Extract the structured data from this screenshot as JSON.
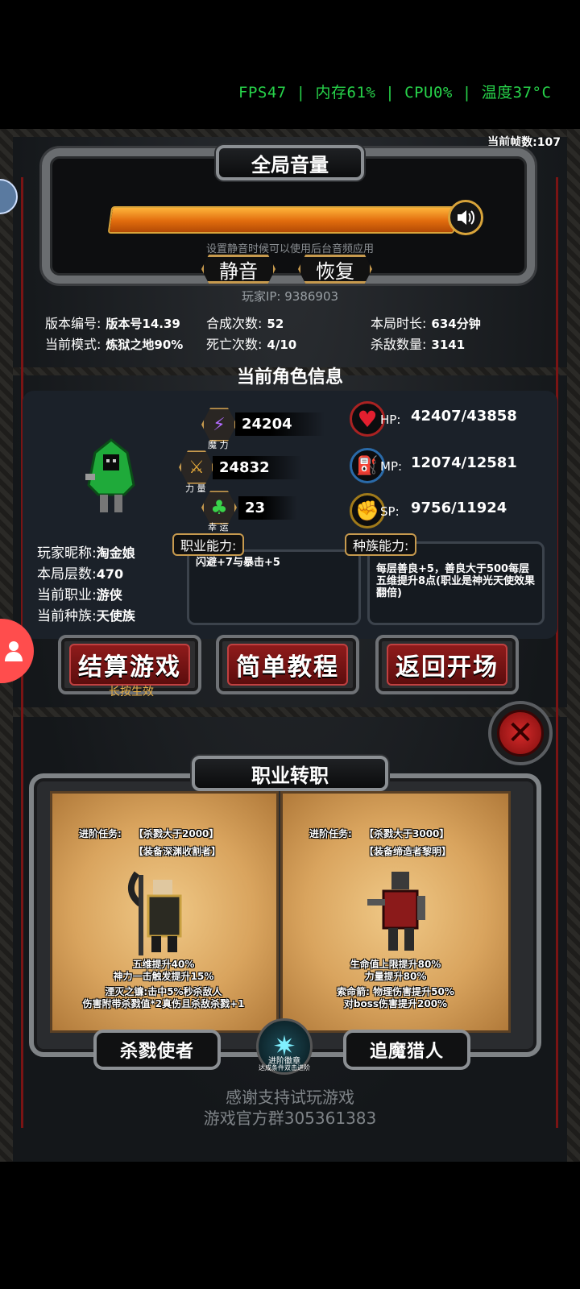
{
  "status_bar": {
    "fps_text": "FPS47 | 内存61% | CPU0% | 温度37°C"
  },
  "game": {
    "frame_count": "当前帧数:107",
    "volume": {
      "title": "全局音量",
      "level_percent": 100,
      "hint": "设置静音时候可以使用后台音频应用",
      "mute_label": "静音",
      "restore_label": "恢复"
    },
    "player_ip": {
      "label": "玩家IP:",
      "value": "9386903"
    },
    "stats": [
      {
        "label": "版本编号:",
        "value": "版本号14.39"
      },
      {
        "label": "合成次数:",
        "value": "52"
      },
      {
        "label": "本局时长:",
        "value": "634分钟"
      },
      {
        "label": "当前模式:",
        "value": "炼狱之地90%"
      },
      {
        "label": "死亡次数:",
        "value": "4/10"
      },
      {
        "label": "杀敌数量:",
        "value": "3141"
      }
    ],
    "section_title": "当前角色信息",
    "attributes": {
      "magic": {
        "caption": "魔 力",
        "value": "24204"
      },
      "strength": {
        "caption": "力 量",
        "value": "24832"
      },
      "luck": {
        "caption": "幸 运",
        "value": "23"
      }
    },
    "resources": {
      "hp": {
        "label": "HP:",
        "value": "42407/43858"
      },
      "mp": {
        "label": "MP:",
        "value": "12074/12581"
      },
      "sp": {
        "label": "SP:",
        "value": "9756/11924"
      }
    },
    "player_info": [
      {
        "label": "玩家昵称:",
        "value": "淘金娘"
      },
      {
        "label": "本局层数:",
        "value": "470"
      },
      {
        "label": "当前职业:",
        "value": "游侠"
      },
      {
        "label": "当前种族:",
        "value": "天使族"
      }
    ],
    "class_ability": {
      "label": "职业能力:",
      "text": "闪避+7与暴击+5"
    },
    "race_ability": {
      "label": "种族能力:",
      "text": "每层善良+5，善良大于500每层五维提升8点(职业是神光天使效果翻倍)"
    },
    "buttons": {
      "settle": "结算游戏",
      "settle_hint": "长按生效",
      "tutorial": "简单教程",
      "back": "返回开场"
    },
    "job_change": {
      "title": "职业转职",
      "left": {
        "task_label": "进阶任务:",
        "task_1": "【杀戮大于2000】",
        "task_2": "【装备深渊收割者】",
        "desc": [
          "五维提升40%",
          "神力一击触发提升15%",
          "湮灭之镰:击中5%秒杀敌人",
          "伤害附带杀戮值*2真伤且杀敌杀戮+1"
        ],
        "button": "杀戮使者"
      },
      "right": {
        "task_label": "进阶任务:",
        "task_1": "【杀戮大于3000】",
        "task_2": "【装备缔造者黎明】",
        "desc": [
          "生命值上限提升80%",
          "力量提升80%",
          "索命箭: 物理伤害提升50%",
          "对boss伤害提升200%"
        ],
        "button": "追魔猎人"
      },
      "badge_label": "进阶徽章",
      "badge_sub": "达成条件双击进阶"
    },
    "footer": {
      "thanks": "感谢支持试玩游戏",
      "group": "游戏官方群305361383"
    }
  },
  "colors": {
    "accent_gold": "#c79a4e",
    "fps_green": "#27d34a",
    "danger_red": "#8f1b1b"
  }
}
